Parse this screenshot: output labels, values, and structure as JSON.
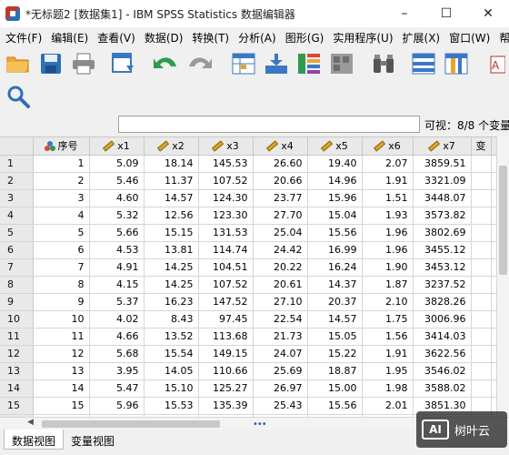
{
  "window": {
    "title": "*无标题2 [数据集1] - IBM SPSS Statistics 数据编辑器",
    "minimize": "–",
    "maximize": "☐",
    "close": "✕"
  },
  "menu": [
    "文件(F)",
    "编辑(E)",
    "查看(V)",
    "数据(D)",
    "转换(T)",
    "分析(A)",
    "图形(G)",
    "实用程序(U)",
    "扩展(X)",
    "窗口(W)",
    "帮助(H)"
  ],
  "toolbar": {
    "icons": [
      "open-folder-icon",
      "save-icon",
      "print-icon",
      "dialog-recall-icon",
      "undo-icon",
      "redo-icon",
      "goto-case-icon",
      "goto-variable-icon",
      "variables-icon",
      "run-descriptives-icon",
      "find-icon",
      "insert-cases-icon",
      "insert-variable-icon",
      "split-file-icon",
      "value-labels-icon",
      "search-icon"
    ],
    "colors": {
      "folder": "#f2a93b",
      "save": "#2d6fb8",
      "undo": "#2e9b4e",
      "grid": "#3b78c4"
    }
  },
  "filter": {
    "value": "",
    "visible_label": "可视：8/8 个变量"
  },
  "grid": {
    "columns": [
      {
        "name": "序号",
        "type": "nominal"
      },
      {
        "name": "x1",
        "type": "scale"
      },
      {
        "name": "x2",
        "type": "scale"
      },
      {
        "name": "x3",
        "type": "scale"
      },
      {
        "name": "x4",
        "type": "scale"
      },
      {
        "name": "x5",
        "type": "scale"
      },
      {
        "name": "x6",
        "type": "scale"
      },
      {
        "name": "x7",
        "type": "scale"
      }
    ],
    "extra_column_label": "变",
    "rows": [
      [
        "1",
        "5.09",
        "18.14",
        "145.53",
        "26.60",
        "19.40",
        "2.07",
        "3859.51"
      ],
      [
        "2",
        "5.46",
        "11.37",
        "107.52",
        "20.66",
        "14.96",
        "1.91",
        "3321.09"
      ],
      [
        "3",
        "4.60",
        "14.57",
        "124.30",
        "23.77",
        "15.96",
        "1.51",
        "3448.07"
      ],
      [
        "4",
        "5.32",
        "12.56",
        "123.30",
        "27.70",
        "15.04",
        "1.93",
        "3573.82"
      ],
      [
        "5",
        "5.66",
        "15.15",
        "131.53",
        "25.04",
        "15.56",
        "1.96",
        "3802.69"
      ],
      [
        "6",
        "4.53",
        "13.81",
        "114.74",
        "24.42",
        "16.99",
        "1.96",
        "3455.12"
      ],
      [
        "7",
        "4.91",
        "14.25",
        "104.51",
        "20.22",
        "16.24",
        "1.90",
        "3453.12"
      ],
      [
        "8",
        "4.15",
        "14.25",
        "107.52",
        "20.61",
        "14.37",
        "1.87",
        "3237.52"
      ],
      [
        "9",
        "5.37",
        "16.23",
        "147.52",
        "27.10",
        "20.37",
        "2.10",
        "3828.26"
      ],
      [
        "10",
        "4.02",
        "8.43",
        "97.45",
        "22.54",
        "14.57",
        "1.75",
        "3006.96"
      ],
      [
        "11",
        "4.66",
        "13.52",
        "113.68",
        "21.73",
        "15.05",
        "1.56",
        "3414.03"
      ],
      [
        "12",
        "5.68",
        "15.54",
        "149.15",
        "24.07",
        "15.22",
        "1.91",
        "3622.56"
      ],
      [
        "13",
        "3.95",
        "14.05",
        "110.66",
        "25.69",
        "18.87",
        "1.95",
        "3546.02"
      ],
      [
        "14",
        "5.47",
        "15.10",
        "125.27",
        "26.97",
        "15.00",
        "1.98",
        "3588.02"
      ],
      [
        "15",
        "5.96",
        "15.53",
        "135.39",
        "25.43",
        "15.56",
        "2.01",
        "3851.30"
      ]
    ],
    "empty_row_number": "16"
  },
  "tabs": [
    "数据视图",
    "变量视图"
  ],
  "watermark": {
    "logo": "AI",
    "text": "树叶云"
  }
}
